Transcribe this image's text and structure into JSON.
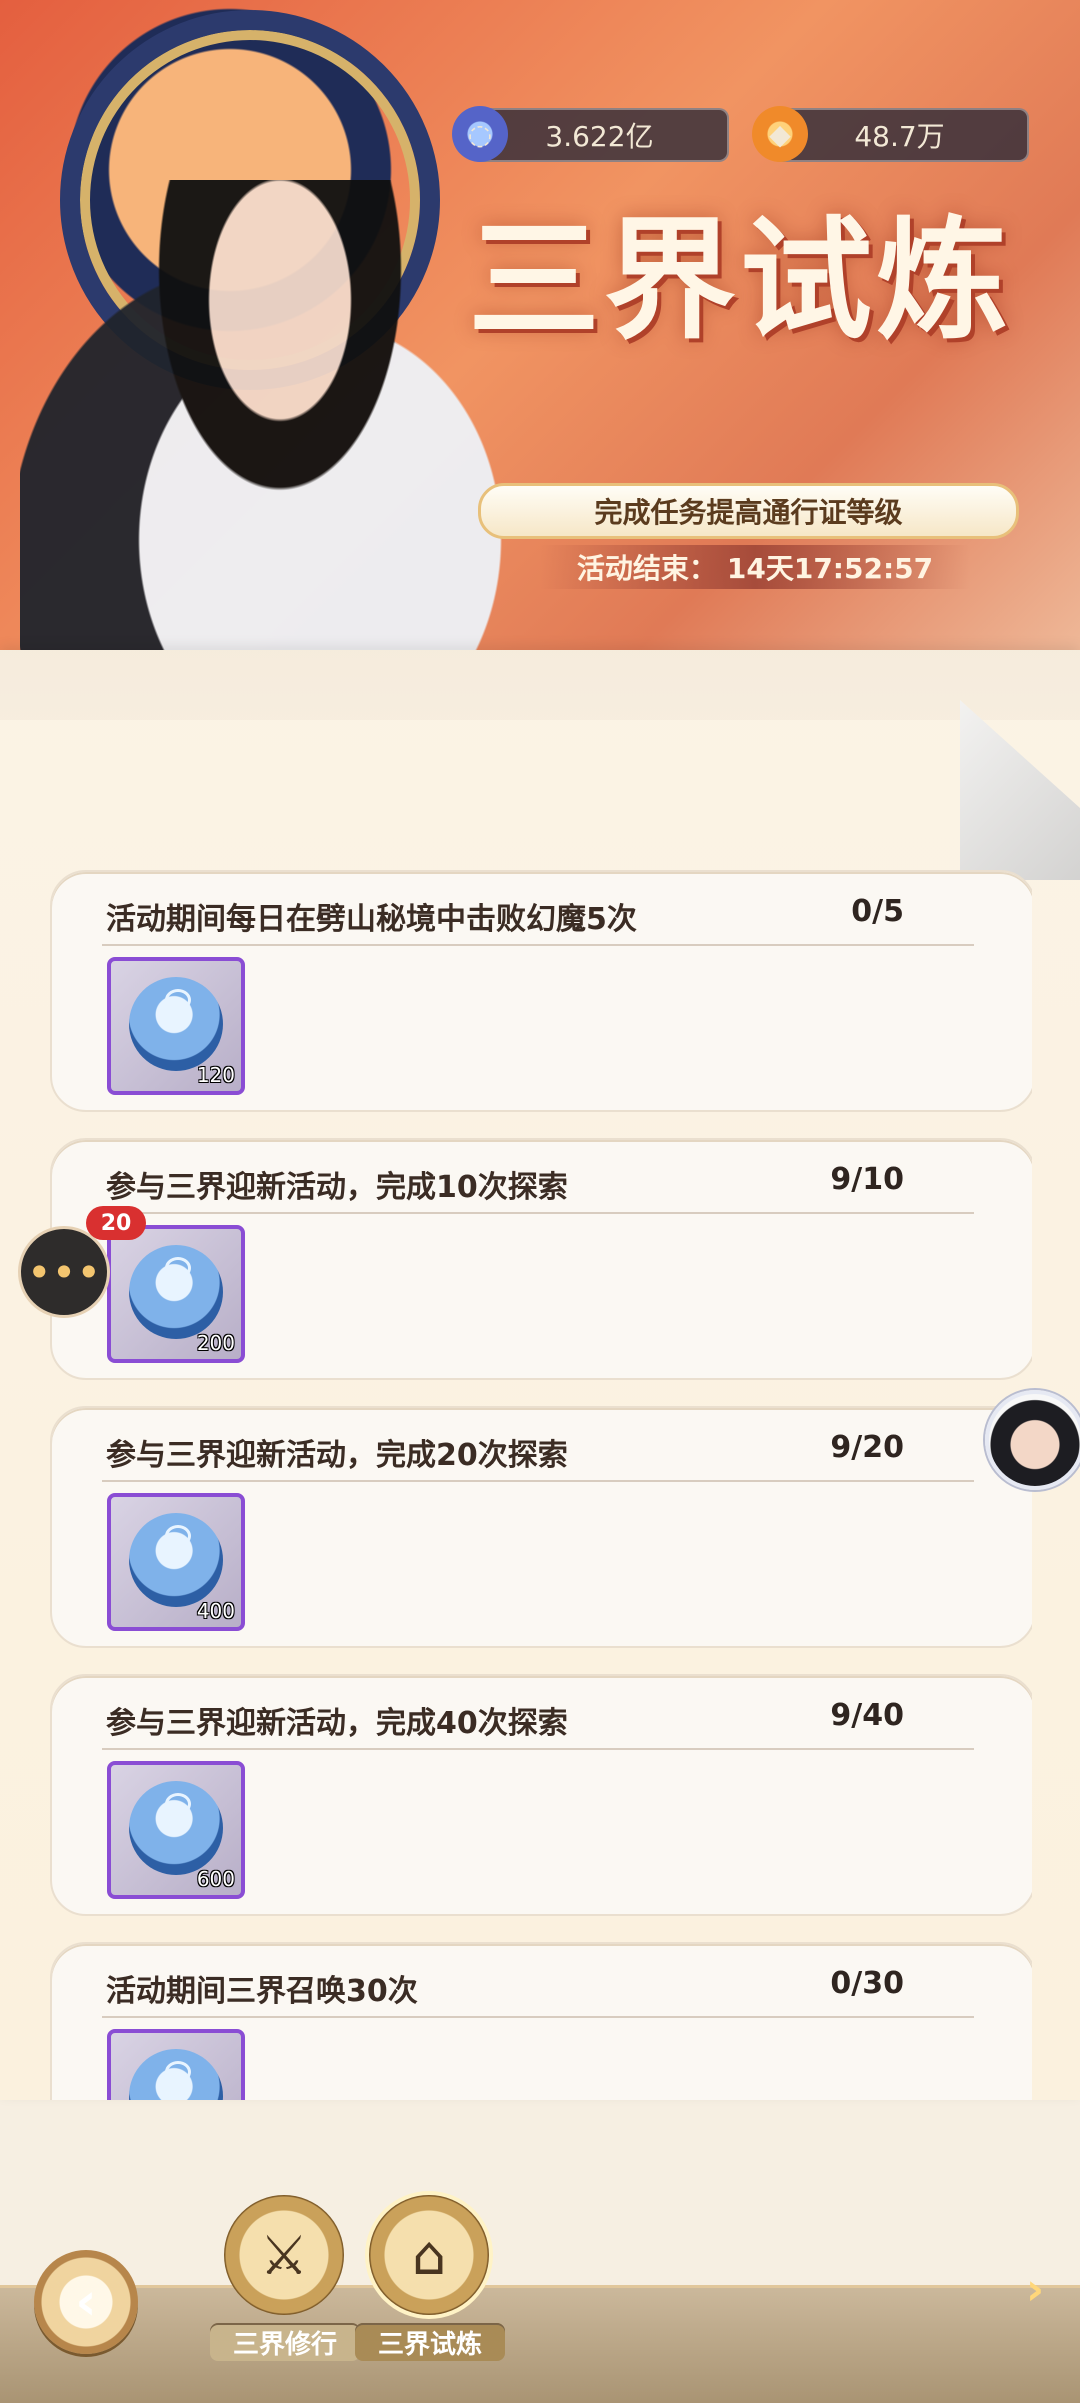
{
  "currency": [
    {
      "icon": "soul-jade-icon",
      "value": "3.622亿"
    },
    {
      "icon": "flame-coin-icon",
      "value": "48.7万"
    }
  ],
  "event": {
    "title": "三界试炼",
    "subtitle": "完成任务提高通行证等级",
    "countdown_label": "活动结束：",
    "countdown_value": "14天17:52:57"
  },
  "tasks": [
    {
      "name": "活动期间每日在劈山秘境中击败幻魔5次",
      "progress": "0/5",
      "reward_qty": "120"
    },
    {
      "name": "参与三界迎新活动，完成10次探索",
      "progress": "9/10",
      "reward_qty": "200"
    },
    {
      "name": "参与三界迎新活动，完成20次探索",
      "progress": "9/20",
      "reward_qty": "400"
    },
    {
      "name": "参与三界迎新活动，完成40次探索",
      "progress": "9/40",
      "reward_qty": "600"
    },
    {
      "name": "活动期间三界召唤30次",
      "progress": "0/30",
      "reward_qty": ""
    }
  ],
  "chat": {
    "badge": "20"
  },
  "nav": {
    "tabs": [
      {
        "label": "三界修行",
        "icon": "scroll-sword-icon",
        "active": false
      },
      {
        "label": "三界试炼",
        "icon": "temple-icon",
        "active": true
      }
    ]
  },
  "colors": {
    "accent": "#e45f3f",
    "reward_border": "#8a4dd4",
    "badge": "#d93030"
  }
}
